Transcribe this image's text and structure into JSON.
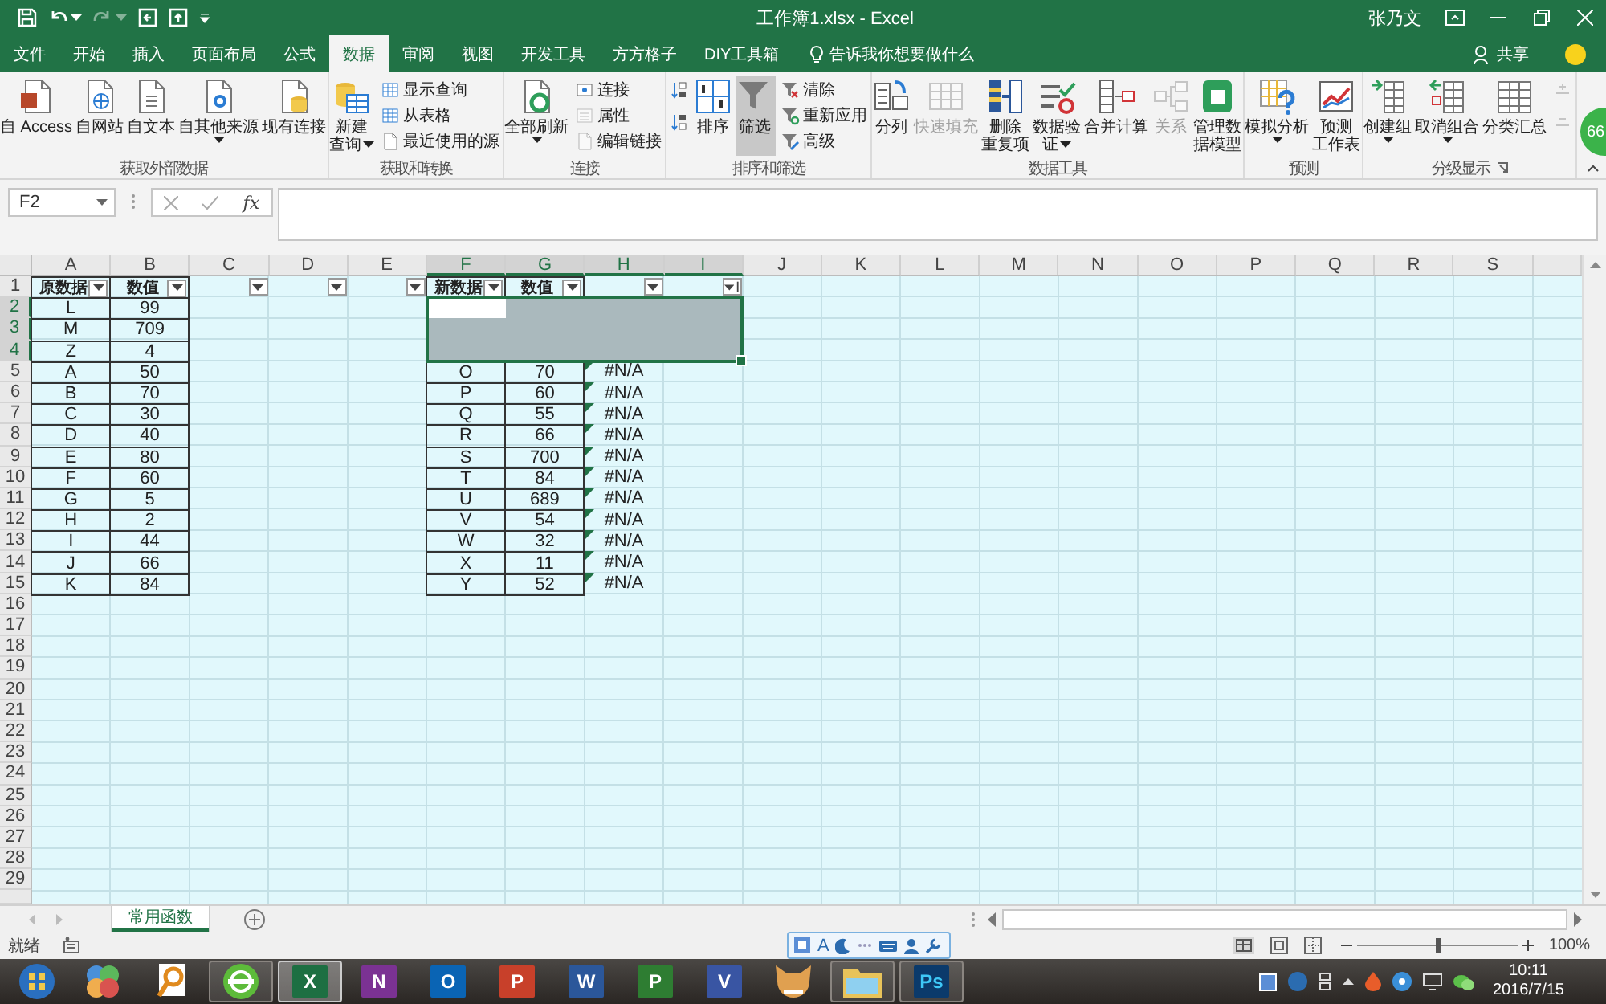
{
  "title_bar": {
    "title": "工作簿1.xlsx - Excel",
    "user": "张乃文"
  },
  "tabs": [
    {
      "label": "文件",
      "selected": false
    },
    {
      "label": "开始",
      "selected": false
    },
    {
      "label": "插入",
      "selected": false
    },
    {
      "label": "页面布局",
      "selected": false
    },
    {
      "label": "公式",
      "selected": false
    },
    {
      "label": "数据",
      "selected": true
    },
    {
      "label": "审阅",
      "selected": false
    },
    {
      "label": "视图",
      "selected": false
    },
    {
      "label": "开发工具",
      "selected": false
    },
    {
      "label": "方方格子",
      "selected": false
    },
    {
      "label": "DIY工具箱",
      "selected": false
    }
  ],
  "tell_me": "告诉我你想要做什么",
  "share": "共享",
  "ribbon": {
    "groups": [
      {
        "label": "获取外部数据",
        "launcher": false,
        "items": [
          {
            "kind": "large",
            "lines": [
              "自 Access"
            ],
            "dropdown": false,
            "pressed": false,
            "disabled": false
          },
          {
            "kind": "large",
            "lines": [
              "自网站"
            ],
            "dropdown": false,
            "pressed": false,
            "disabled": false
          },
          {
            "kind": "large",
            "lines": [
              "自文本"
            ],
            "dropdown": false,
            "pressed": false,
            "disabled": false
          },
          {
            "kind": "large",
            "lines": [
              "自其他来源"
            ],
            "dropdown": true,
            "pressed": false,
            "disabled": false
          },
          {
            "kind": "large",
            "lines": [
              "现有连接"
            ],
            "dropdown": false,
            "pressed": false,
            "disabled": false
          }
        ]
      },
      {
        "label": "获取和转换",
        "launcher": false,
        "items": [
          {
            "kind": "large",
            "lines": [
              "新建",
              "查询"
            ],
            "dropdown": true,
            "pressed": false,
            "disabled": false
          },
          {
            "kind": "stack",
            "items": [
              {
                "label": "显示查询",
                "disabled": false
              },
              {
                "label": "从表格",
                "disabled": false
              },
              {
                "label": "最近使用的源",
                "disabled": false
              }
            ]
          }
        ]
      },
      {
        "label": "连接",
        "launcher": false,
        "items": [
          {
            "kind": "large",
            "lines": [
              "全部刷新"
            ],
            "dropdown": true,
            "pressed": false,
            "disabled": false
          },
          {
            "kind": "stack",
            "items": [
              {
                "label": "连接",
                "disabled": false
              },
              {
                "label": "属性",
                "disabled": true
              },
              {
                "label": "编辑链接",
                "disabled": true
              }
            ]
          }
        ]
      },
      {
        "label": "排序和筛选",
        "launcher": false,
        "items": [
          {
            "kind": "stack",
            "items": [
              {
                "disabled": false
              },
              {
                "disabled": false
              }
            ]
          },
          {
            "kind": "large",
            "lines": [
              "排序"
            ],
            "dropdown": false,
            "pressed": false,
            "disabled": false
          },
          {
            "kind": "large",
            "lines": [
              "筛选"
            ],
            "dropdown": false,
            "pressed": true,
            "disabled": false
          },
          {
            "kind": "stack",
            "items": [
              {
                "label": "清除",
                "disabled": false
              },
              {
                "label": "重新应用",
                "disabled": false
              },
              {
                "label": "高级",
                "disabled": false
              }
            ]
          }
        ]
      },
      {
        "label": "数据工具",
        "launcher": false,
        "items": [
          {
            "kind": "large",
            "lines": [
              "分列"
            ],
            "dropdown": false,
            "pressed": false,
            "disabled": false
          },
          {
            "kind": "large",
            "lines": [
              "快速填充"
            ],
            "dropdown": false,
            "pressed": false,
            "disabled": true
          },
          {
            "kind": "large",
            "lines": [
              "删除",
              "重复项"
            ],
            "dropdown": false,
            "pressed": false,
            "disabled": false
          },
          {
            "kind": "large",
            "lines": [
              "数据验",
              "证"
            ],
            "dropdown": true,
            "pressed": false,
            "disabled": false
          },
          {
            "kind": "large",
            "lines": [
              "合并计算"
            ],
            "dropdown": false,
            "pressed": false,
            "disabled": false
          },
          {
            "kind": "large",
            "lines": [
              "关系"
            ],
            "dropdown": false,
            "pressed": false,
            "disabled": true
          },
          {
            "kind": "large",
            "lines": [
              "管理数",
              "据模型"
            ],
            "dropdown": false,
            "pressed": false,
            "disabled": false
          }
        ]
      },
      {
        "label": "预测",
        "launcher": false,
        "items": [
          {
            "kind": "large",
            "lines": [
              "模拟分析"
            ],
            "dropdown": true,
            "pressed": false,
            "disabled": false
          },
          {
            "kind": "large",
            "lines": [
              "预测",
              "工作表"
            ],
            "dropdown": false,
            "pressed": false,
            "disabled": false
          }
        ]
      },
      {
        "label": "分级显示",
        "launcher": true,
        "items": [
          {
            "kind": "large",
            "lines": [
              "创建组"
            ],
            "dropdown": true,
            "pressed": false,
            "disabled": false
          },
          {
            "kind": "large",
            "lines": [
              "取消组合"
            ],
            "dropdown": true,
            "pressed": false,
            "disabled": false
          },
          {
            "kind": "large",
            "lines": [
              "分类汇总"
            ],
            "dropdown": false,
            "pressed": false,
            "disabled": false
          },
          {
            "kind": "stack",
            "items": [
              {
                "disabled": true
              },
              {
                "disabled": true
              }
            ]
          }
        ]
      }
    ]
  },
  "badge": "66",
  "formula_bar": {
    "name_box": "F2",
    "function_label": "fx"
  },
  "sheet": {
    "columns": [
      {
        "label": "A",
        "selected": false
      },
      {
        "label": "B",
        "selected": false
      },
      {
        "label": "C",
        "selected": false
      },
      {
        "label": "D",
        "selected": false
      },
      {
        "label": "E",
        "selected": false
      },
      {
        "label": "F",
        "selected": true
      },
      {
        "label": "G",
        "selected": true
      },
      {
        "label": "H",
        "selected": true
      },
      {
        "label": "I",
        "selected": true
      },
      {
        "label": "J",
        "selected": false
      },
      {
        "label": "K",
        "selected": false
      },
      {
        "label": "L",
        "selected": false
      },
      {
        "label": "M",
        "selected": false
      },
      {
        "label": "N",
        "selected": false
      },
      {
        "label": "O",
        "selected": false
      },
      {
        "label": "P",
        "selected": false
      },
      {
        "label": "Q",
        "selected": false
      },
      {
        "label": "R",
        "selected": false
      },
      {
        "label": "S",
        "selected": false
      }
    ],
    "rows": [
      {
        "label": "1",
        "selected": false
      },
      {
        "label": "2",
        "selected": true
      },
      {
        "label": "3",
        "selected": true
      },
      {
        "label": "4",
        "selected": true
      },
      {
        "label": "5",
        "selected": false
      },
      {
        "label": "6",
        "selected": false
      },
      {
        "label": "7",
        "selected": false
      },
      {
        "label": "8",
        "selected": false
      },
      {
        "label": "9",
        "selected": false
      },
      {
        "label": "10",
        "selected": false
      },
      {
        "label": "11",
        "selected": false
      },
      {
        "label": "12",
        "selected": false
      },
      {
        "label": "13",
        "selected": false
      },
      {
        "label": "14",
        "selected": false
      },
      {
        "label": "15",
        "selected": false
      },
      {
        "label": "16",
        "selected": false
      },
      {
        "label": "17",
        "selected": false
      },
      {
        "label": "18",
        "selected": false
      },
      {
        "label": "19",
        "selected": false
      },
      {
        "label": "20",
        "selected": false
      },
      {
        "label": "21",
        "selected": false
      },
      {
        "label": "22",
        "selected": false
      },
      {
        "label": "23",
        "selected": false
      },
      {
        "label": "24",
        "selected": false
      },
      {
        "label": "25",
        "selected": false
      },
      {
        "label": "26",
        "selected": false
      },
      {
        "label": "27",
        "selected": false
      },
      {
        "label": "28",
        "selected": false
      },
      {
        "label": "29",
        "selected": false
      }
    ],
    "tables": [
      {
        "headers": [
          {
            "label": "原数据",
            "kind": "dropdown"
          },
          {
            "label": "数值",
            "kind": "dropdown"
          },
          {
            "kind": "dropdown"
          },
          {
            "kind": "dropdown"
          },
          {
            "kind": "dropdown"
          }
        ],
        "rows": [
          {
            "cells": [
              "L",
              "99"
            ]
          },
          {
            "cells": [
              "M",
              "709"
            ]
          },
          {
            "cells": [
              "Z",
              "4"
            ]
          },
          {
            "cells": [
              "A",
              "50"
            ]
          },
          {
            "cells": [
              "B",
              "70"
            ]
          },
          {
            "cells": [
              "C",
              "30"
            ]
          },
          {
            "cells": [
              "D",
              "40"
            ]
          },
          {
            "cells": [
              "E",
              "80"
            ]
          },
          {
            "cells": [
              "F",
              "60"
            ]
          },
          {
            "cells": [
              "G",
              "5"
            ]
          },
          {
            "cells": [
              "H",
              "2"
            ]
          },
          {
            "cells": [
              "I",
              "44"
            ]
          },
          {
            "cells": [
              "J",
              "66"
            ]
          },
          {
            "cells": [
              "K",
              "84"
            ]
          }
        ]
      },
      {
        "headers": [
          {
            "label": "新数据",
            "kind": "dropdown"
          },
          {
            "label": "数值",
            "kind": "dropdown"
          },
          {
            "kind": "dropdown"
          },
          {
            "kind": "sorted"
          }
        ],
        "rows": [
          {
            "selected": true
          },
          {
            "selected": true
          },
          {
            "selected": true
          },
          {
            "cells": [
              "O",
              "70",
              "#N/A"
            ],
            "selected": false,
            "flagged": true
          },
          {
            "cells": [
              "P",
              "60",
              "#N/A"
            ],
            "selected": false,
            "flagged": true
          },
          {
            "cells": [
              "Q",
              "55",
              "#N/A"
            ],
            "selected": false,
            "flagged": true
          },
          {
            "cells": [
              "R",
              "66",
              "#N/A"
            ],
            "selected": false,
            "flagged": true
          },
          {
            "cells": [
              "S",
              "700",
              "#N/A"
            ],
            "selected": false,
            "flagged": true
          },
          {
            "cells": [
              "T",
              "84",
              "#N/A"
            ],
            "selected": false,
            "flagged": true
          },
          {
            "cells": [
              "U",
              "689",
              "#N/A"
            ],
            "selected": false,
            "flagged": true
          },
          {
            "cells": [
              "V",
              "54",
              "#N/A"
            ],
            "selected": false,
            "flagged": true
          },
          {
            "cells": [
              "W",
              "32",
              "#N/A"
            ],
            "selected": false,
            "flagged": true
          },
          {
            "cells": [
              "X",
              "11",
              "#N/A"
            ],
            "selected": false,
            "flagged": true
          },
          {
            "cells": [
              "Y",
              "52",
              "#N/A"
            ],
            "selected": false,
            "flagged": true
          }
        ]
      }
    ]
  },
  "sheet_tabs": [
    {
      "label": "常用函数",
      "selected": true
    }
  ],
  "status_bar": {
    "status": "就绪",
    "ime_mode": "A",
    "zoom": {
      "label": "100%",
      "level": 0.5
    }
  },
  "taskbar": {
    "apps": [
      {
        "kind": "petals",
        "running": false,
        "selected": false
      },
      {
        "kind": "magnifier",
        "running": false,
        "selected": false
      },
      {
        "kind": "browser",
        "running": true,
        "selected": false
      },
      {
        "kind": "tile",
        "label": "X",
        "color": "#1d6f42",
        "running": true,
        "selected": true
      },
      {
        "kind": "tile",
        "label": "N",
        "color": "#7b3293",
        "running": false,
        "selected": false
      },
      {
        "kind": "tile",
        "label": "O",
        "color": "#0a64b4",
        "running": false,
        "selected": false
      },
      {
        "kind": "tile",
        "label": "P",
        "color": "#c8402a",
        "running": false,
        "selected": false
      },
      {
        "kind": "tile",
        "label": "W",
        "color": "#2b579a",
        "running": false,
        "selected": false
      },
      {
        "kind": "tile",
        "label": "P",
        "color": "#2e7d32",
        "running": false,
        "selected": false
      },
      {
        "kind": "tile",
        "label": "V",
        "color": "#3955a3",
        "running": false,
        "selected": false
      },
      {
        "kind": "cat",
        "running": false,
        "selected": false
      },
      {
        "kind": "folder",
        "running": true,
        "selected": false
      },
      {
        "kind": "tile",
        "label": "Ps",
        "color": "#0b3a6b",
        "running": true,
        "selected": false
      }
    ],
    "time": "10:11",
    "date": "2016/7/15"
  }
}
